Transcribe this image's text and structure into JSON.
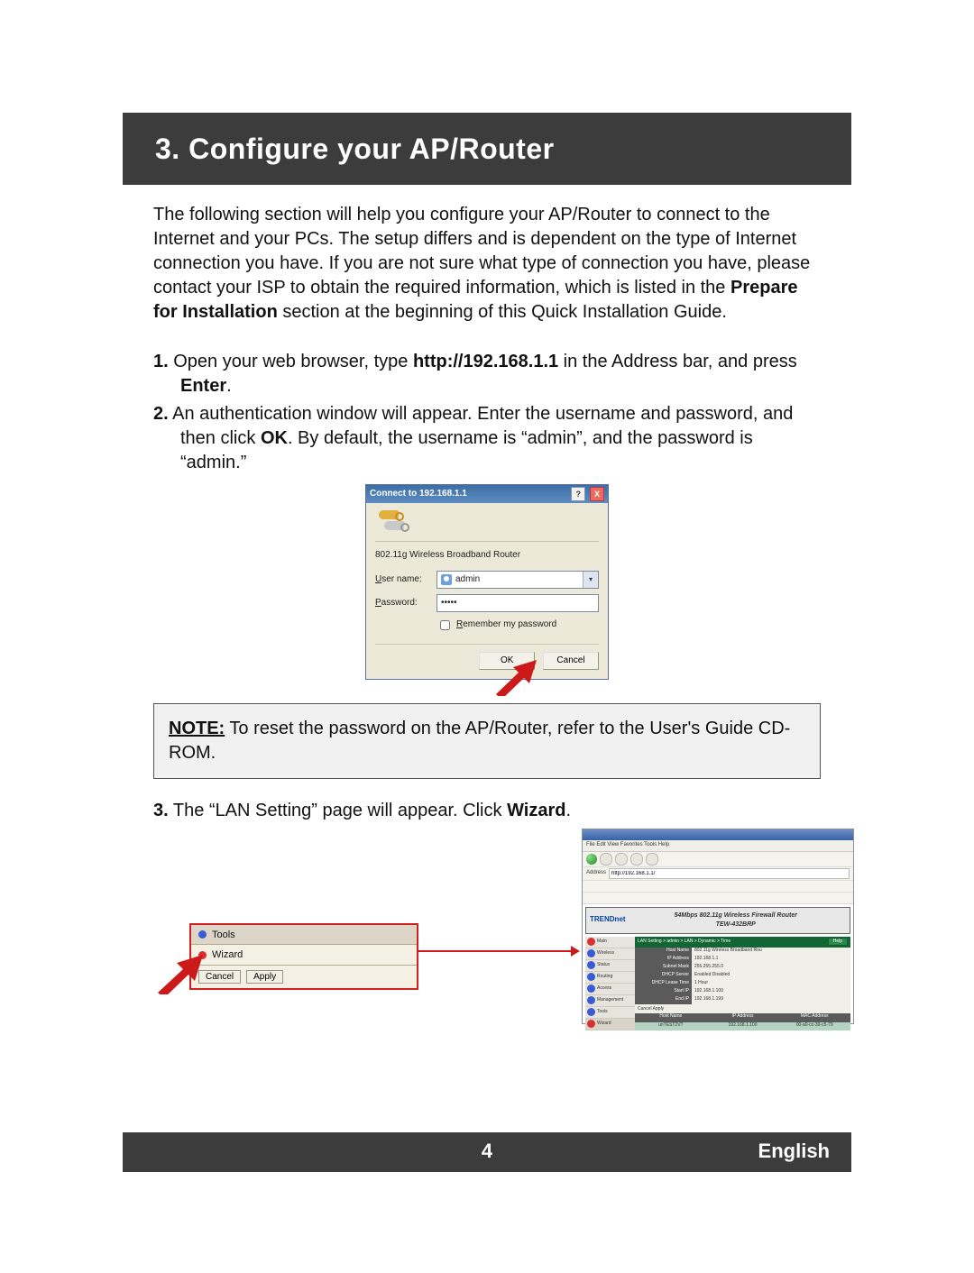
{
  "header": {
    "title": "3. Configure your AP/Router"
  },
  "intro": {
    "text_before_bold": "The following section will help you configure your AP/Router to connect to the Internet and your PCs. The setup differs and is dependent on the type of Internet connection you have. If you are not sure what type of connection you have, please contact your ISP to obtain the required information, which is listed in the ",
    "bold": "Prepare for Installation",
    "text_after_bold": " section at the beginning of this Quick Installation Guide."
  },
  "steps": {
    "s1": {
      "num": "1.",
      "a": " Open your web browser, type ",
      "b": "http://192.168.1.1",
      "c": " in the Address bar, and press ",
      "d": "Enter",
      "e": "."
    },
    "s2": {
      "num": "2.",
      "a": " An authentication window will appear. Enter the username and password, and then click ",
      "b": "OK",
      "c": ". By default, the username is “admin”, and the password is “admin.”"
    },
    "s3": {
      "num": "3.",
      "a": " The “LAN Setting” page will appear.  Click ",
      "b": "Wizard",
      "c": "."
    }
  },
  "auth_dialog": {
    "title": "Connect to 192.168.1.1",
    "router_name": "802.11g Wireless Broadband Router",
    "user_label": "User name:",
    "user_value": "admin",
    "pass_label": "Password:",
    "pass_value": "•••••",
    "remember": "Remember my password",
    "ok": "OK",
    "cancel": "Cancel"
  },
  "note": {
    "label": "NOTE:",
    "text": " To reset the password on the AP/Router, refer to the User's Guide CD-ROM."
  },
  "wizard_panel": {
    "tools": "Tools",
    "wizard": "Wizard",
    "cancel": "Cancel",
    "apply": "Apply"
  },
  "browser_shot": {
    "menubar": "File  Edit  View  Favorites  Tools  Help",
    "address_label": "Address",
    "address": "http://192.168.1.1/",
    "logo": "TRENDnet",
    "title_line": "54Mbps 802.11g Wireless Firewall Router",
    "model": "TEW-432BRP",
    "crumb": "LAN Setting > admin > LAN > Dynamic > Time",
    "help": "Help",
    "nav": [
      "Main",
      "Wireless",
      "Status",
      "Routing",
      "Access",
      "Management",
      "Tools",
      "Wizard"
    ],
    "info": [
      {
        "k": "Host Name",
        "v": "802.11g Wireless Broadband Rou"
      },
      {
        "k": "IP Address",
        "v": "192.168.1.1"
      },
      {
        "k": "Subnet Mask",
        "v": "255.255.255.0"
      },
      {
        "k": "DHCP Server",
        "v": "Enabled  Disabled"
      },
      {
        "k": "DHCP Lease Time",
        "v": "1 Hour"
      },
      {
        "k": "Start IP",
        "v": "192.168.1.100"
      },
      {
        "k": "End IP",
        "v": "192.168.1.199"
      }
    ],
    "btns": "Cancel   Apply",
    "client_hdr": [
      "Host Name",
      "IP Address",
      "MAC Address"
    ],
    "client_row": [
      "unTEST2VT",
      "192.168.1.100",
      "00-a0-cc-39-c5-79"
    ]
  },
  "footer": {
    "page": "4",
    "lang": "English"
  }
}
